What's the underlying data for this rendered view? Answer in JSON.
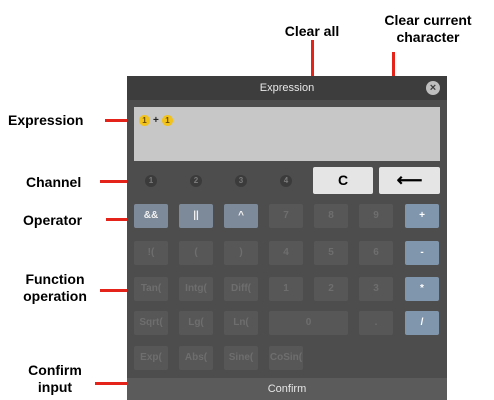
{
  "annotations": {
    "clear_all": "Clear all",
    "clear_current_1": "Clear current",
    "clear_current_2": "character",
    "expression": "Expression",
    "channel": "Channel",
    "operator": "Operator",
    "function_1": "Function",
    "function_2": "operation",
    "confirm_1": "Confirm",
    "confirm_2": "input"
  },
  "dialog": {
    "title": "Expression",
    "close_glyph": "×",
    "expression_tokens": [
      "1",
      "+",
      "1"
    ],
    "confirm_label": "Confirm"
  },
  "channels": [
    "1",
    "2",
    "3",
    "4"
  ],
  "clear_label": "C",
  "backspace_glyph": "⟵",
  "rows": [
    [
      "&&",
      "||",
      "^",
      "7",
      "8",
      "9",
      "+"
    ],
    [
      "!(",
      "(",
      ")",
      "4",
      "5",
      "6",
      "-"
    ],
    [
      "Tan(",
      "Intg(",
      "Diff(",
      "1",
      "2",
      "3",
      "*"
    ],
    [
      "Sqrt(",
      "Lg(",
      "Ln(",
      "0",
      ".",
      "/"
    ],
    [
      "Exp(",
      "Abs(",
      "Sine(",
      "CoSin("
    ]
  ],
  "colors": {
    "accent_red": "#e4231b",
    "channel_yellow": "#f2c31a",
    "operator_blue": "#8096ad"
  }
}
